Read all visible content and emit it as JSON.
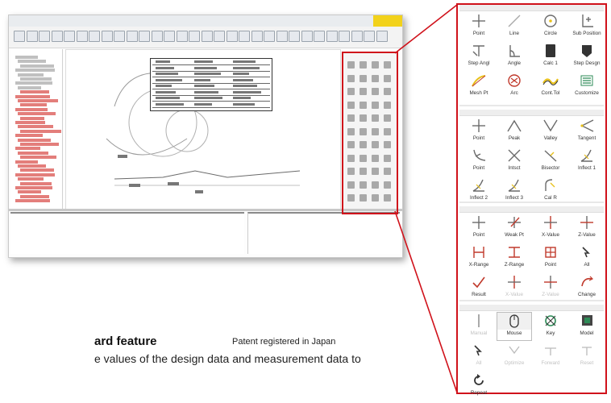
{
  "caption": {
    "heading": "ard feature",
    "patent": "Patent registered in Japan",
    "body": "e values of the design data and measurement data to"
  },
  "colors": {
    "highlight_border": "#d0121b",
    "tool_icon": "#6b6b6b",
    "icon_accent_yellow": "#e8c01a",
    "icon_accent_red": "#c0392b",
    "icon_accent_green": "#2e8b57"
  },
  "palette": {
    "sections": [
      {
        "name": "create",
        "tools": [
          {
            "label": "Point",
            "icon": "plus-point-icon"
          },
          {
            "label": "Line",
            "icon": "line-icon"
          },
          {
            "label": "Circle",
            "icon": "circle-icon"
          },
          {
            "label": "Sub Position",
            "icon": "sub-position-icon"
          },
          {
            "label": "Step Angl",
            "icon": "step-angle-icon"
          },
          {
            "label": "Angle",
            "icon": "angle-icon"
          },
          {
            "label": "Calc 1",
            "icon": "calculator-icon"
          },
          {
            "label": "Step Desgn",
            "icon": "step-design-icon"
          },
          {
            "label": "Mesh Pt",
            "icon": "mesh-point-icon"
          },
          {
            "label": "Arc",
            "icon": "arc-icon"
          },
          {
            "label": "Cont.Tol",
            "icon": "contour-tolerance-icon"
          },
          {
            "label": "Customize",
            "icon": "customize-icon"
          }
        ]
      },
      {
        "name": "detect",
        "tools": [
          {
            "label": "Point",
            "icon": "plus-point-icon"
          },
          {
            "label": "Peak",
            "icon": "peak-icon"
          },
          {
            "label": "Valley",
            "icon": "valley-icon"
          },
          {
            "label": "Tangent",
            "icon": "tangent-icon"
          },
          {
            "label": "Point",
            "icon": "point-curve-icon"
          },
          {
            "label": "Intsct",
            "icon": "intersect-icon"
          },
          {
            "label": "Bisector",
            "icon": "bisector-icon"
          },
          {
            "label": "Inflect 1",
            "icon": "inflection-icon"
          },
          {
            "label": "Inflect 2",
            "icon": "inflection-icon"
          },
          {
            "label": "Inflect 3",
            "icon": "inflection-icon"
          },
          {
            "label": "Cal R",
            "icon": "radius-calc-icon"
          }
        ]
      },
      {
        "name": "measure",
        "tools": [
          {
            "label": "Point",
            "icon": "plus-point-icon"
          },
          {
            "label": "Weak Pt",
            "icon": "weak-point-icon"
          },
          {
            "label": "X-Value",
            "icon": "x-value-icon"
          },
          {
            "label": "Z-Value",
            "icon": "z-value-icon"
          },
          {
            "label": "X-Range",
            "icon": "x-range-icon"
          },
          {
            "label": "Z-Range",
            "icon": "z-range-icon"
          },
          {
            "label": "Point",
            "icon": "point-range-icon"
          },
          {
            "label": "All",
            "icon": "all-icon"
          },
          {
            "label": "Result",
            "icon": "result-icon"
          },
          {
            "label": "X-Value",
            "icon": "x-value-icon",
            "disabled": true
          },
          {
            "label": "Z-Value",
            "icon": "z-value-icon",
            "disabled": true
          },
          {
            "label": "Change",
            "icon": "change-icon"
          }
        ]
      },
      {
        "name": "control",
        "tools": [
          {
            "label": "Manual",
            "icon": "manual-icon",
            "disabled": true
          },
          {
            "label": "Mouse",
            "icon": "mouse-icon",
            "highlighted": true
          },
          {
            "label": "Key",
            "icon": "key-icon"
          },
          {
            "label": "Model",
            "icon": "model-icon"
          },
          {
            "label": "All",
            "icon": "all-icon",
            "disabled": true
          },
          {
            "label": "Optimize",
            "icon": "optimize-icon",
            "disabled": true
          },
          {
            "label": "Forward",
            "icon": "forward-icon",
            "disabled": true
          },
          {
            "label": "Reset",
            "icon": "reset-icon",
            "disabled": true
          },
          {
            "label": "Repeat",
            "icon": "repeat-icon"
          }
        ]
      }
    ]
  }
}
